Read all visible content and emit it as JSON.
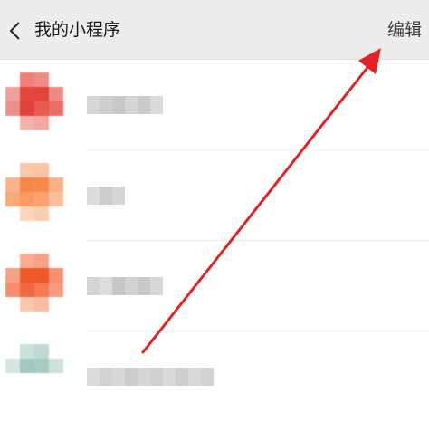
{
  "header": {
    "back_icon": "chevron-left-icon",
    "title": "我的小程序",
    "edit_label": "编辑"
  },
  "colors": {
    "nav_background": "#ededed",
    "annotation_arrow": "#e32222",
    "app1_icon": "#e8514a",
    "app2_icon": "#f79a60",
    "app3_icon": "#f26a3e",
    "app4_icon": "#a9cdc6"
  },
  "annotation": {
    "type": "arrow",
    "points_to": "edit-button"
  },
  "apps": [
    {
      "name_visible": false
    },
    {
      "name_visible": false
    },
    {
      "name_visible": false
    },
    {
      "name_visible": false
    }
  ]
}
